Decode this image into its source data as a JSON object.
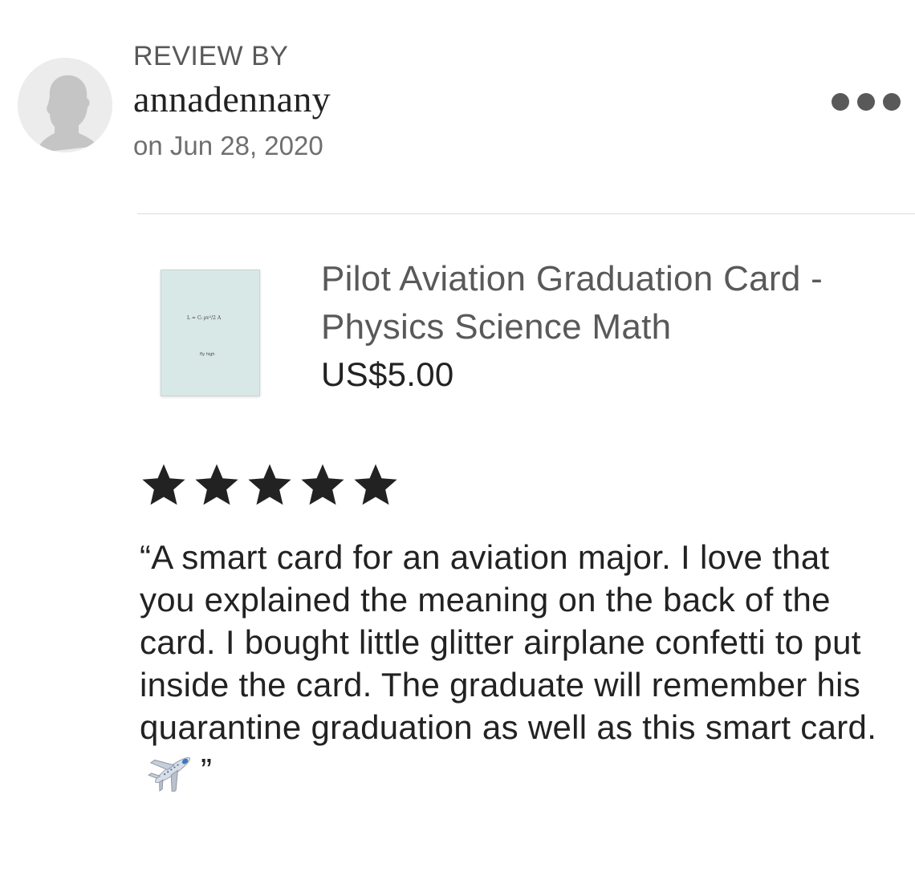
{
  "review": {
    "label": "REVIEW BY",
    "username": "annadennany",
    "date": "on Jun 28, 2020",
    "more_icon": "more-horizontal-icon"
  },
  "listing": {
    "title": "Pilot Aviation Graduation Card - Physics Science Math",
    "price": "US$5.00",
    "thumbnail": {
      "formula": "L = Cₗ ρv²/2 A",
      "caption": "fly high",
      "color": "#d8e8e6"
    }
  },
  "rating": {
    "stars": 5,
    "max": 5,
    "icon": "star-icon",
    "color": "#222222"
  },
  "body": {
    "text": "“A smart card for an aviation major. I love that you explained the meaning on the back of the card. I bought little glitter airplane confetti to put inside the card. The graduate will remember his quarantine graduation as well as this smart card.",
    "emoji": "airplane-icon",
    "close_quote": "”"
  },
  "colors": {
    "text": "#222222",
    "muted": "#595959",
    "divider": "#dcdcdc"
  }
}
